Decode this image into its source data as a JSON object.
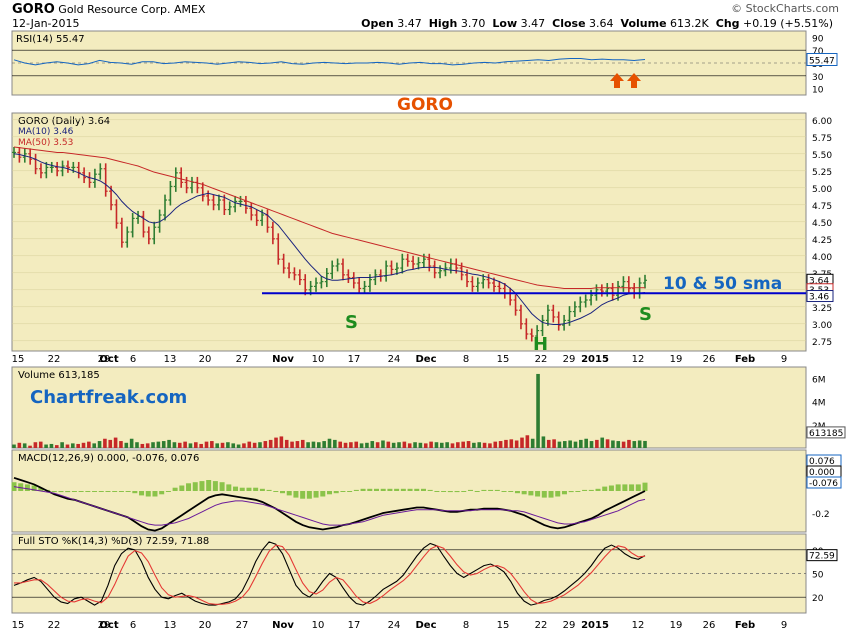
{
  "header": {
    "ticker": "GORO",
    "company": "Gold Resource Corp.",
    "exchange": "AMEX",
    "date": "12-Jan-2015",
    "open_label": "Open",
    "open": "3.47",
    "high_label": "High",
    "high": "3.70",
    "low_label": "Low",
    "low": "3.47",
    "close_label": "Close",
    "close": "3.64",
    "volume_label": "Volume",
    "volume": "613.2K",
    "chg_label": "Chg",
    "chg": "+0.19 (+5.51%)",
    "brand": "© StockCharts.com"
  },
  "colors": {
    "panel_bg": "#f3ecbf",
    "price_up": "#2e7d32",
    "price_down": "#c62828",
    "ma10": "#1a237e",
    "ma50": "#c62828",
    "blue_line": "#0000cc",
    "annot_green": "#1e8c1e",
    "annot_blue": "#1565c0",
    "annot_orange": "#e65100"
  },
  "annotations": {
    "goro": "GORO",
    "sma": "10 & 50 sma",
    "s_left": "S",
    "h": "H",
    "s_right": "S",
    "chartfreak": "Chartfreak.com"
  },
  "chart_data": [
    {
      "type": "line",
      "title": "RSI(14) 55.47",
      "series": [
        {
          "name": "RSI(14)",
          "last": 55.47,
          "values": [
            55,
            50,
            47,
            50,
            52,
            50,
            47,
            49,
            54,
            51,
            50,
            48,
            52,
            52,
            49,
            50,
            52,
            51,
            50,
            48,
            50,
            52,
            51,
            49,
            50,
            52,
            49,
            48,
            50,
            51,
            50,
            49,
            50,
            50,
            51,
            50,
            48,
            50,
            51,
            49,
            49,
            47,
            48,
            50,
            51,
            50,
            52,
            53,
            54,
            55,
            54,
            56,
            57,
            57,
            55,
            56,
            55,
            55,
            54,
            55.47
          ]
        }
      ],
      "y_ticks": [
        10,
        30,
        50,
        70,
        90
      ],
      "reference_lines": [
        30,
        70
      ]
    },
    {
      "type": "candlestick",
      "title": "GORO (Daily) 3.64",
      "legend": [
        {
          "name": "MA(10)",
          "value": 3.46
        },
        {
          "name": "MA(50)",
          "value": 3.53
        }
      ],
      "y_ticks": [
        2.75,
        3.0,
        3.25,
        3.5,
        3.75,
        4.0,
        4.25,
        4.5,
        4.75,
        5.0,
        5.25,
        5.5,
        5.75,
        6.0
      ],
      "ylim": [
        2.6,
        6.1
      ],
      "x_ticks": [
        "15",
        "22",
        "29",
        "Oct",
        "6",
        "13",
        "20",
        "27",
        "Nov",
        "10",
        "17",
        "24",
        "Dec",
        "8",
        "15",
        "22",
        "29",
        "2015",
        "12",
        "19",
        "26",
        "Feb",
        "9"
      ],
      "close_values": [
        5.52,
        5.45,
        5.5,
        5.42,
        5.28,
        5.22,
        5.3,
        5.3,
        5.25,
        5.32,
        5.3,
        5.3,
        5.22,
        5.15,
        5.08,
        5.2,
        5.28,
        4.95,
        4.75,
        4.48,
        4.2,
        4.35,
        4.55,
        4.58,
        4.35,
        4.25,
        4.42,
        4.6,
        4.82,
        5.02,
        5.22,
        5.08,
        5.0,
        5.08,
        5.0,
        4.88,
        4.82,
        4.75,
        4.82,
        4.68,
        4.72,
        4.8,
        4.8,
        4.7,
        4.6,
        4.52,
        4.6,
        4.42,
        4.25,
        3.95,
        3.82,
        3.75,
        3.72,
        3.65,
        3.5,
        3.55,
        3.6,
        3.62,
        3.74,
        3.85,
        3.88,
        3.72,
        3.68,
        3.6,
        3.52,
        3.55,
        3.65,
        3.72,
        3.7,
        3.85,
        3.8,
        3.82,
        3.95,
        3.92,
        3.88,
        3.9,
        3.95,
        3.85,
        3.75,
        3.78,
        3.82,
        3.88,
        3.82,
        3.72,
        3.62,
        3.55,
        3.6,
        3.65,
        3.6,
        3.55,
        3.52,
        3.45,
        3.35,
        3.2,
        3.0,
        2.85,
        2.82,
        2.9,
        3.05,
        3.2,
        3.1,
        2.98,
        3.05,
        3.18,
        3.25,
        3.32,
        3.35,
        3.42,
        3.5,
        3.48,
        3.52,
        3.42,
        3.55,
        3.62,
        3.52,
        3.45,
        3.6,
        3.64
      ],
      "ma10_values": [
        5.5,
        5.49,
        5.47,
        5.45,
        5.42,
        5.38,
        5.35,
        5.33,
        5.31,
        5.3,
        5.28,
        5.25,
        5.22,
        5.18,
        5.15,
        5.13,
        5.1,
        5.05,
        4.98,
        4.9,
        4.8,
        4.72,
        4.65,
        4.6,
        4.55,
        4.5,
        4.48,
        4.5,
        4.55,
        4.62,
        4.7,
        4.76,
        4.8,
        4.84,
        4.88,
        4.9,
        4.92,
        4.9,
        4.88,
        4.86,
        4.82,
        4.78,
        4.76,
        4.74,
        4.72,
        4.68,
        4.64,
        4.6,
        4.52,
        4.45,
        4.35,
        4.25,
        4.15,
        4.05,
        3.95,
        3.86,
        3.78,
        3.7,
        3.66,
        3.64,
        3.64,
        3.65,
        3.66,
        3.67,
        3.68,
        3.68,
        3.68,
        3.69,
        3.7,
        3.71,
        3.72,
        3.74,
        3.76,
        3.79,
        3.8,
        3.82,
        3.83,
        3.83,
        3.83,
        3.82,
        3.8,
        3.79,
        3.78,
        3.77,
        3.75,
        3.73,
        3.72,
        3.7,
        3.68,
        3.65,
        3.62,
        3.58,
        3.52,
        3.45,
        3.35,
        3.25,
        3.15,
        3.08,
        3.02,
        3.0,
        2.99,
        2.99,
        3.0,
        3.02,
        3.05,
        3.08,
        3.12,
        3.16,
        3.22,
        3.28,
        3.32,
        3.35,
        3.38,
        3.42,
        3.44,
        3.45,
        3.45,
        3.46
      ],
      "ma50_values": [
        5.6,
        5.59,
        5.58,
        5.57,
        5.56,
        5.55,
        5.54,
        5.53,
        5.52,
        5.52,
        5.51,
        5.5,
        5.49,
        5.48,
        5.47,
        5.46,
        5.45,
        5.44,
        5.42,
        5.4,
        5.38,
        5.36,
        5.34,
        5.32,
        5.29,
        5.26,
        5.23,
        5.21,
        5.19,
        5.17,
        5.15,
        5.13,
        5.11,
        5.09,
        5.07,
        5.05,
        5.02,
        4.99,
        4.96,
        4.93,
        4.9,
        4.87,
        4.84,
        4.81,
        4.78,
        4.75,
        4.72,
        4.69,
        4.66,
        4.63,
        4.6,
        4.57,
        4.54,
        4.51,
        4.48,
        4.45,
        4.42,
        4.39,
        4.36,
        4.33,
        4.31,
        4.29,
        4.27,
        4.25,
        4.23,
        4.21,
        4.19,
        4.17,
        4.15,
        4.13,
        4.11,
        4.09,
        4.07,
        4.05,
        4.03,
        4.01,
        3.99,
        3.97,
        3.95,
        3.93,
        3.91,
        3.89,
        3.87,
        3.85,
        3.83,
        3.81,
        3.79,
        3.77,
        3.75,
        3.73,
        3.71,
        3.69,
        3.67,
        3.65,
        3.63,
        3.61,
        3.59,
        3.57,
        3.56,
        3.55,
        3.54,
        3.53,
        3.52,
        3.52,
        3.52,
        3.52,
        3.52,
        3.52,
        3.53,
        3.53,
        3.53,
        3.53,
        3.53,
        3.53,
        3.53,
        3.53,
        3.53,
        3.53
      ],
      "last_values": [
        "3.64",
        "3.53",
        "3.46"
      ],
      "horizontal_line": 3.45
    },
    {
      "type": "bar",
      "title": "Volume 613,185",
      "y_ticks": [
        "2M",
        "4M",
        "6M"
      ],
      "last": "613185",
      "values": [
        0.3,
        0.45,
        0.4,
        0.2,
        0.5,
        0.55,
        0.3,
        0.35,
        0.25,
        0.5,
        0.3,
        0.4,
        0.35,
        0.45,
        0.55,
        0.4,
        0.6,
        0.8,
        0.7,
        0.9,
        0.6,
        0.45,
        0.8,
        0.5,
        0.35,
        0.4,
        0.5,
        0.55,
        0.6,
        0.7,
        0.5,
        0.45,
        0.55,
        0.4,
        0.5,
        0.35,
        0.55,
        0.6,
        0.4,
        0.45,
        0.5,
        0.4,
        0.3,
        0.4,
        0.55,
        0.45,
        0.5,
        0.6,
        0.7,
        0.9,
        1.0,
        0.7,
        0.55,
        0.6,
        0.7,
        0.5,
        0.55,
        0.5,
        0.6,
        0.8,
        0.7,
        0.55,
        0.45,
        0.5,
        0.55,
        0.4,
        0.45,
        0.6,
        0.5,
        0.65,
        0.55,
        0.45,
        0.5,
        0.55,
        0.4,
        0.5,
        0.45,
        0.4,
        0.55,
        0.5,
        0.45,
        0.5,
        0.4,
        0.5,
        0.55,
        0.6,
        0.45,
        0.5,
        0.45,
        0.4,
        0.55,
        0.6,
        0.7,
        0.75,
        0.65,
        0.9,
        1.1,
        0.8,
        6.4,
        1.0,
        0.7,
        0.75,
        0.55,
        0.6,
        0.65,
        0.55,
        0.7,
        0.8,
        0.6,
        0.7,
        0.9,
        0.75,
        0.65,
        0.6,
        0.55,
        0.7,
        0.6,
        0.65,
        0.61
      ]
    },
    {
      "type": "line",
      "title": "MACD(12,26,9) 0.000, -0.076, 0.076",
      "y_ticks": [
        0.0,
        -0.2
      ],
      "last_values": [
        "0.076",
        "0.000",
        "-0.076"
      ],
      "series": [
        {
          "name": "MACD",
          "values": [
            0.12,
            0.1,
            0.08,
            0.06,
            0.03,
            0.0,
            -0.03,
            -0.05,
            -0.07,
            -0.08,
            -0.1,
            -0.12,
            -0.14,
            -0.16,
            -0.18,
            -0.2,
            -0.22,
            -0.24,
            -0.28,
            -0.32,
            -0.35,
            -0.36,
            -0.34,
            -0.3,
            -0.26,
            -0.22,
            -0.18,
            -0.14,
            -0.1,
            -0.06,
            -0.04,
            -0.03,
            -0.04,
            -0.05,
            -0.06,
            -0.07,
            -0.08,
            -0.1,
            -0.13,
            -0.16,
            -0.2,
            -0.24,
            -0.28,
            -0.31,
            -0.33,
            -0.34,
            -0.35,
            -0.34,
            -0.33,
            -0.31,
            -0.3,
            -0.28,
            -0.26,
            -0.24,
            -0.22,
            -0.2,
            -0.19,
            -0.18,
            -0.17,
            -0.16,
            -0.15,
            -0.15,
            -0.16,
            -0.17,
            -0.18,
            -0.19,
            -0.19,
            -0.18,
            -0.17,
            -0.17,
            -0.16,
            -0.16,
            -0.16,
            -0.17,
            -0.18,
            -0.2,
            -0.22,
            -0.25,
            -0.28,
            -0.31,
            -0.33,
            -0.34,
            -0.33,
            -0.31,
            -0.29,
            -0.27,
            -0.25,
            -0.22,
            -0.18,
            -0.15,
            -0.12,
            -0.09,
            -0.06,
            -0.03,
            0.0
          ]
        },
        {
          "name": "Signal",
          "values": [
            0.04,
            0.03,
            0.02,
            0.01,
            0.0,
            -0.01,
            -0.02,
            -0.04,
            -0.06,
            -0.08,
            -0.1,
            -0.12,
            -0.14,
            -0.16,
            -0.18,
            -0.2,
            -0.22,
            -0.24,
            -0.26,
            -0.28,
            -0.3,
            -0.31,
            -0.31,
            -0.3,
            -0.29,
            -0.27,
            -0.25,
            -0.22,
            -0.19,
            -0.16,
            -0.13,
            -0.11,
            -0.1,
            -0.09,
            -0.09,
            -0.1,
            -0.11,
            -0.12,
            -0.14,
            -0.16,
            -0.18,
            -0.2,
            -0.22,
            -0.24,
            -0.26,
            -0.28,
            -0.3,
            -0.31,
            -0.31,
            -0.31,
            -0.3,
            -0.29,
            -0.28,
            -0.26,
            -0.24,
            -0.22,
            -0.21,
            -0.2,
            -0.19,
            -0.18,
            -0.17,
            -0.17,
            -0.17,
            -0.17,
            -0.18,
            -0.18,
            -0.18,
            -0.18,
            -0.18,
            -0.17,
            -0.17,
            -0.17,
            -0.17,
            -0.17,
            -0.18,
            -0.18,
            -0.19,
            -0.21,
            -0.23,
            -0.25,
            -0.27,
            -0.29,
            -0.3,
            -0.3,
            -0.29,
            -0.28,
            -0.26,
            -0.24,
            -0.22,
            -0.2,
            -0.18,
            -0.15,
            -0.12,
            -0.09,
            -0.076
          ]
        }
      ]
    },
    {
      "type": "line",
      "title": "Full STO %K(14,3) %D(3) 72.59, 71.88",
      "y_ticks": [
        20,
        50,
        80
      ],
      "last_values": [
        "72.59"
      ],
      "series": [
        {
          "name": "%K",
          "values": [
            35,
            38,
            42,
            45,
            40,
            30,
            20,
            14,
            12,
            18,
            20,
            15,
            10,
            15,
            35,
            60,
            75,
            82,
            80,
            65,
            45,
            30,
            20,
            18,
            22,
            25,
            20,
            15,
            12,
            10,
            10,
            12,
            14,
            18,
            28,
            45,
            65,
            80,
            90,
            87,
            75,
            55,
            35,
            25,
            20,
            28,
            40,
            50,
            45,
            32,
            20,
            12,
            10,
            15,
            22,
            30,
            35,
            40,
            48,
            60,
            72,
            82,
            88,
            85,
            72,
            60,
            50,
            45,
            50,
            55,
            60,
            62,
            58,
            52,
            40,
            25,
            15,
            10,
            12,
            16,
            18,
            22,
            28,
            35,
            42,
            50,
            60,
            72,
            82,
            86,
            82,
            75,
            70,
            68,
            72.59
          ]
        },
        {
          "name": "%D",
          "values": [
            38,
            38,
            40,
            42,
            42,
            36,
            28,
            20,
            15,
            14,
            17,
            18,
            15,
            13,
            20,
            36,
            55,
            72,
            79,
            76,
            65,
            48,
            32,
            23,
            20,
            21,
            22,
            20,
            16,
            12,
            11,
            11,
            12,
            15,
            20,
            30,
            46,
            63,
            78,
            86,
            84,
            73,
            55,
            38,
            27,
            24,
            29,
            39,
            45,
            42,
            32,
            21,
            14,
            12,
            16,
            22,
            29,
            35,
            41,
            49,
            60,
            71,
            81,
            85,
            82,
            72,
            61,
            52,
            48,
            50,
            55,
            59,
            60,
            57,
            50,
            39,
            27,
            17,
            12,
            13,
            15,
            19,
            23,
            29,
            35,
            43,
            51,
            61,
            71,
            80,
            85,
            83,
            76,
            71,
            71.88
          ]
        }
      ]
    }
  ]
}
